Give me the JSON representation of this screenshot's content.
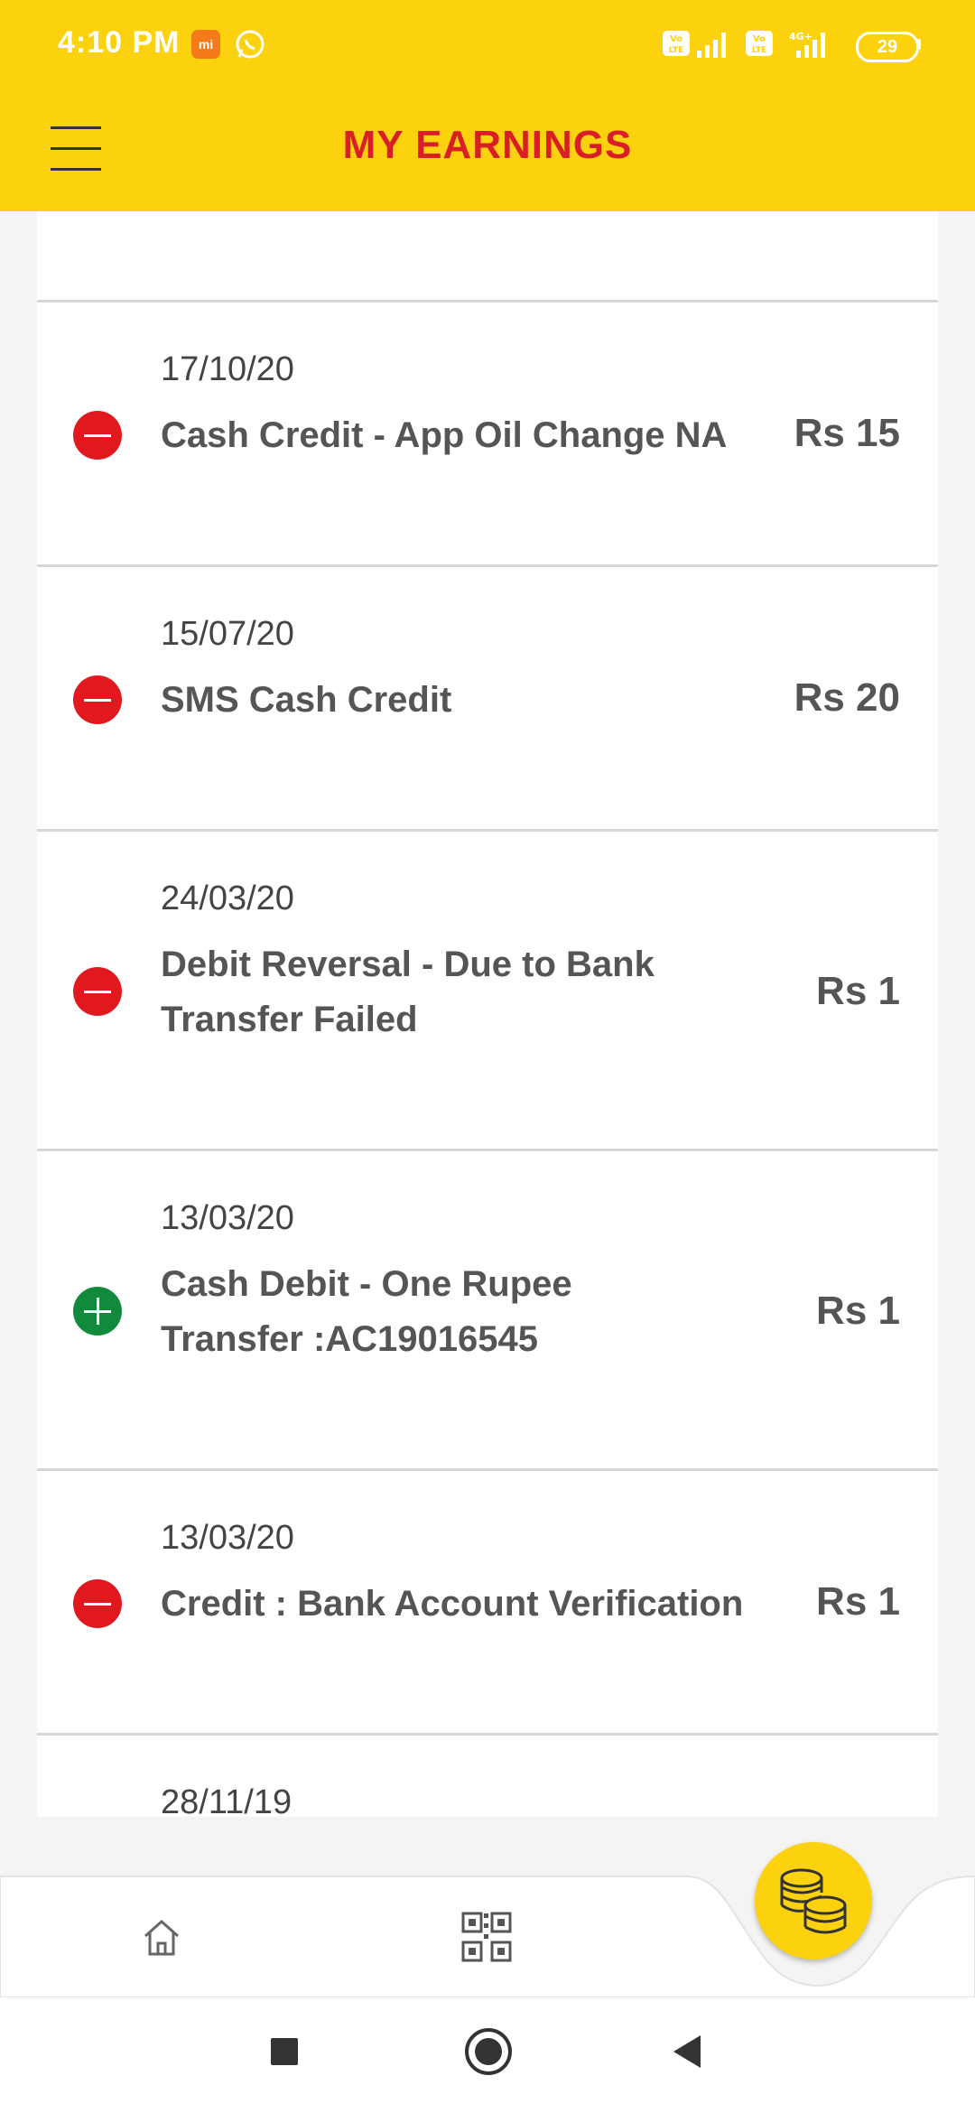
{
  "status_bar": {
    "time": "4:10 PM",
    "mi_badge": "mi",
    "network1": "VoLTE",
    "network2": "VoLTE 4G+",
    "battery": "29"
  },
  "app_bar": {
    "title": "MY EARNINGS",
    "menu_icon": "hamburger-menu-icon"
  },
  "transactions": [
    {
      "date": "17/10/20",
      "description": "Cash Credit - App Oil Change NA",
      "amount": "Rs 15",
      "type": "minus"
    },
    {
      "date": "15/07/20",
      "description": "SMS Cash Credit",
      "amount": "Rs 20",
      "type": "minus"
    },
    {
      "date": "24/03/20",
      "description": "Debit Reversal - Due to Bank Transfer Failed",
      "amount": "Rs 1",
      "type": "minus"
    },
    {
      "date": "13/03/20",
      "description": "Cash Debit - One Rupee Transfer :AC19016545",
      "amount": "Rs 1",
      "type": "plus"
    },
    {
      "date": "13/03/20",
      "description": "Credit : Bank Account Verification",
      "amount": "Rs 1",
      "type": "minus"
    },
    {
      "date": "28/11/19",
      "description": "",
      "amount": "",
      "type": ""
    }
  ],
  "bottom_nav": {
    "items": [
      "home-icon",
      "qr-code-icon",
      "coins-icon"
    ]
  },
  "colors": {
    "brand_yellow": "#fbd20d",
    "title_red": "#d91f26",
    "minus_red": "#e1191f",
    "plus_green": "#128a3c"
  }
}
